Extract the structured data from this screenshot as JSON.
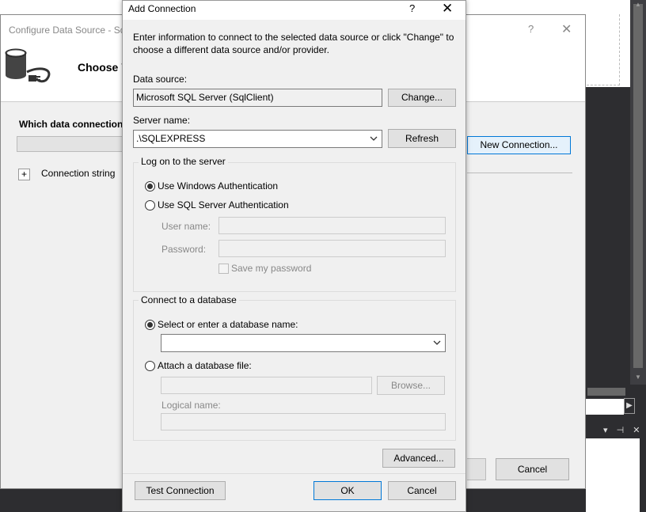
{
  "wizard": {
    "title": "Configure Data Source - Sq",
    "help": "?",
    "close": "✕",
    "heading": "Choose Y",
    "question": "Which data connection",
    "connection_string_label": "Connection string",
    "expander": "+",
    "new_connection_label": "New Connection...",
    "cancel_label": "Cancel"
  },
  "dialog": {
    "title": "Add Connection",
    "help": "?",
    "close": "✕",
    "instructions": "Enter information to connect to the selected data source or click \"Change\" to choose a different data source and/or provider.",
    "data_source": {
      "label": "Data source:",
      "value": "Microsoft SQL Server (SqlClient)",
      "change_label": "Change..."
    },
    "server": {
      "label": "Server name:",
      "value": ".\\SQLEXPRESS",
      "refresh_label": "Refresh"
    },
    "logon": {
      "group_title": "Log on to the server",
      "windows_auth": "Use Windows Authentication",
      "sql_auth": "Use SQL Server Authentication",
      "selected": "windows",
      "username_label": "User name:",
      "password_label": "Password:",
      "save_password_label": "Save my password"
    },
    "database": {
      "group_title": "Connect to a database",
      "select_label": "Select or enter a database name:",
      "attach_label": "Attach a database file:",
      "selected": "select",
      "db_name_value": "",
      "browse_label": "Browse...",
      "logical_name_label": "Logical name:"
    },
    "advanced_label": "Advanced...",
    "test_connection_label": "Test Connection",
    "ok_label": "OK",
    "cancel_label": "Cancel"
  },
  "ide": {
    "scroll_up": "▲",
    "scroll_down": "▼",
    "scroll_right": "▶",
    "panel_icons": "▾ ⊣ ✕"
  },
  "colors": {
    "accent": "#0078d7",
    "ide_dark": "#2d2d30",
    "dialog_bg": "#f0f0f0"
  }
}
